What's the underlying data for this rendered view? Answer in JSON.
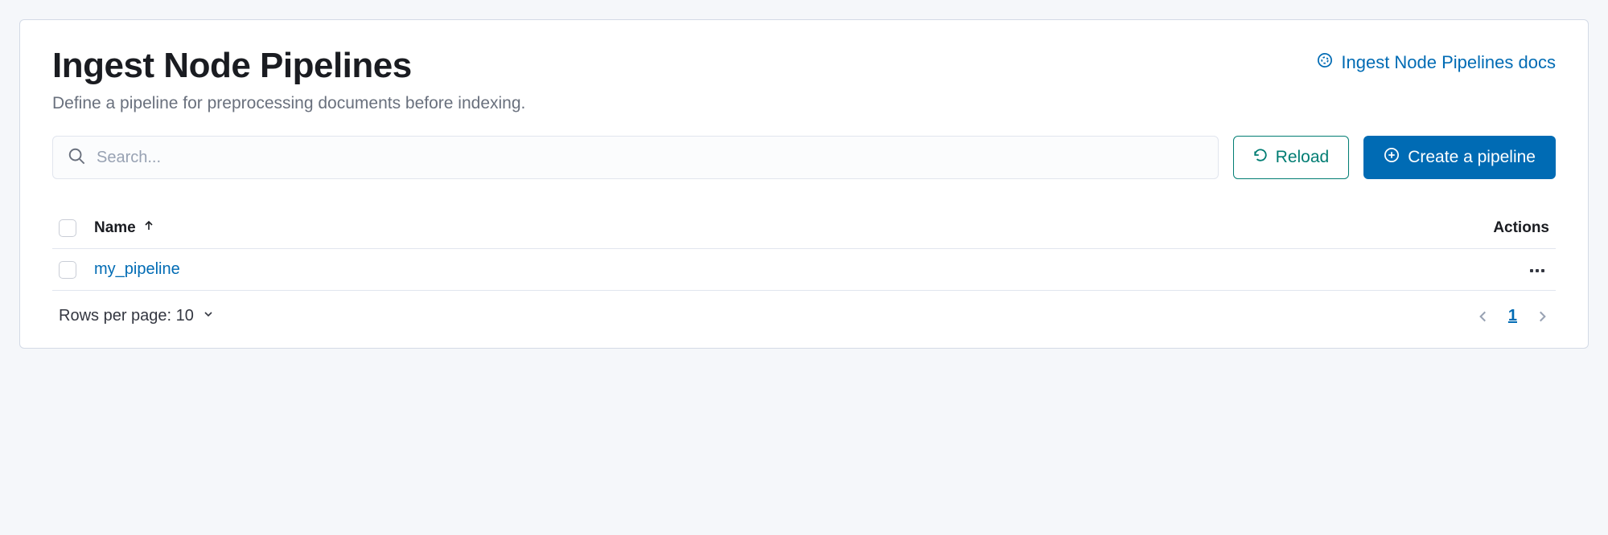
{
  "header": {
    "title": "Ingest Node Pipelines",
    "subtitle": "Define a pipeline for preprocessing documents before indexing.",
    "docs_link": "Ingest Node Pipelines docs"
  },
  "toolbar": {
    "search_placeholder": "Search...",
    "reload_label": "Reload",
    "create_label": "Create a pipeline"
  },
  "table": {
    "columns": {
      "name": "Name",
      "actions": "Actions"
    },
    "rows": [
      {
        "name": "my_pipeline"
      }
    ]
  },
  "footer": {
    "rows_per_page_label": "Rows per page: 10",
    "current_page": "1"
  }
}
